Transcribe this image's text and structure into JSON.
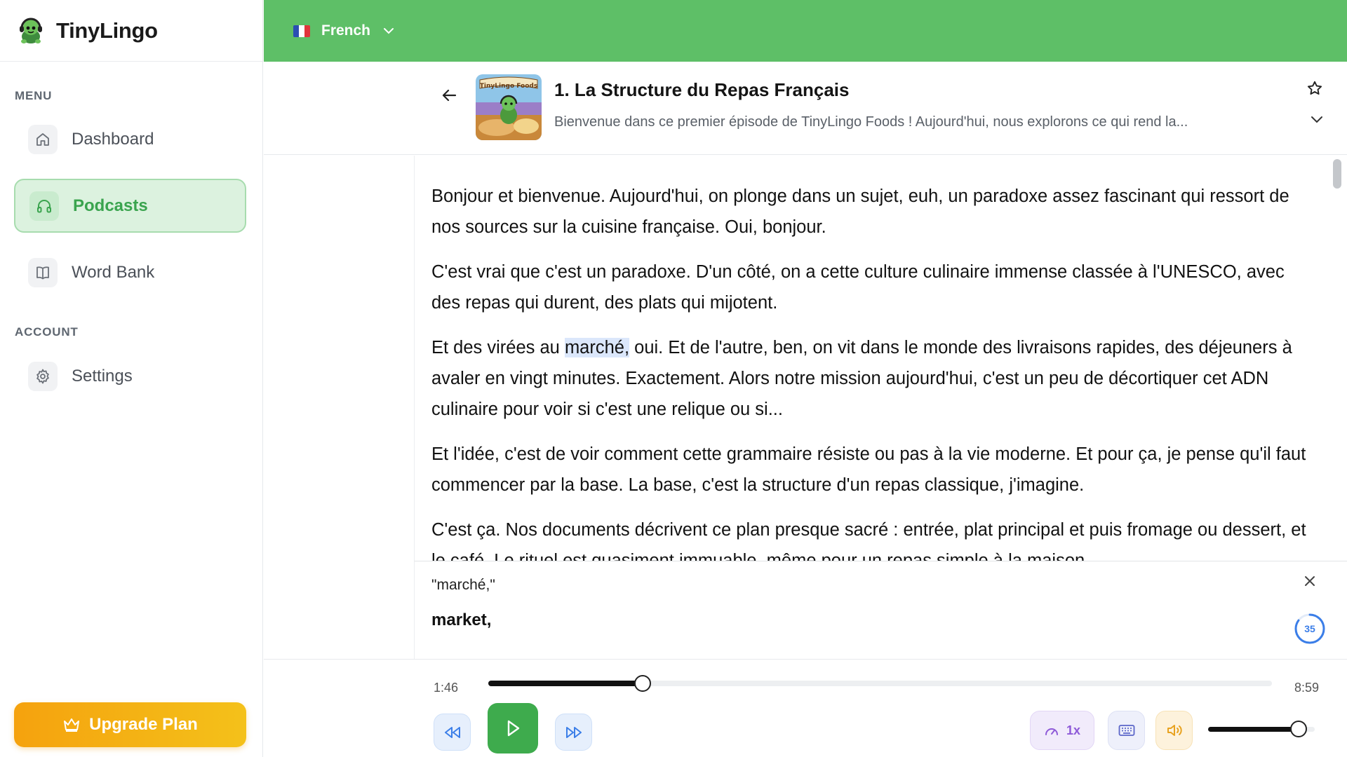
{
  "app": {
    "name": "TinyLingo"
  },
  "sidebar": {
    "menu_label": "MENU",
    "account_label": "ACCOUNT",
    "items": [
      {
        "label": "Dashboard",
        "icon": "home-icon",
        "active": false
      },
      {
        "label": "Podcasts",
        "icon": "headphones-icon",
        "active": true
      },
      {
        "label": "Word Bank",
        "icon": "book-icon",
        "active": false
      },
      {
        "label": "Settings",
        "icon": "gear-icon",
        "active": false
      }
    ],
    "upgrade_label": "Upgrade Plan"
  },
  "topbar": {
    "language": "French",
    "flag": "fr-flag-icon"
  },
  "episode": {
    "title": "1. La Structure du Repas Français",
    "subtitle": "Bienvenue dans ce premier épisode de TinyLingo Foods ! Aujourd'hui, nous explorons ce qui rend la...",
    "cover_text": "TinyLingo Foods"
  },
  "transcript": {
    "p1": "Bonjour et bienvenue. Aujourd'hui, on plonge dans un sujet, euh, un paradoxe assez fascinant qui ressort de nos sources sur la cuisine française. Oui, bonjour.",
    "p2": "C'est vrai que c'est un paradoxe. D'un côté, on a cette culture culinaire immense classée à l'UNESCO, avec des repas qui durent, des plats qui mijotent.",
    "p3_before": "Et des virées au ",
    "p3_highlight": "marché,",
    "p3_after": " oui. Et de l'autre, ben, on vit dans le monde des livraisons rapides, des déjeuners à avaler en vingt minutes. Exactement. Alors notre mission aujourd'hui, c'est un peu de décortiquer cet ADN culinaire pour voir si c'est une relique ou si...",
    "p4": "Et l'idée, c'est de voir comment cette grammaire résiste ou pas à la vie moderne. Et pour ça, je pense qu'il faut commencer par la base. La base, c'est la structure d'un repas classique, j'imagine.",
    "p5": "C'est ça. Nos documents décrivent ce plan presque sacré : entrée, plat principal et puis fromage ou dessert, et le café. Le rituel est quasiment immuable, même pour un repas simple à la maison."
  },
  "popup": {
    "word": "\"marché,\"",
    "translation": "market,",
    "countdown": "35",
    "countdown_fraction": 0.85
  },
  "player": {
    "current_time": "1:46",
    "duration": "8:59",
    "progress": 0.197,
    "speed_label": "1x",
    "volume": 0.85
  },
  "colors": {
    "brand_green": "#5ebf67",
    "active_nav_bg": "#dcf2df",
    "play_button": "#3eab4d",
    "highlight": "#dbe7fb",
    "upgrade_orange": "#f5a20e"
  }
}
